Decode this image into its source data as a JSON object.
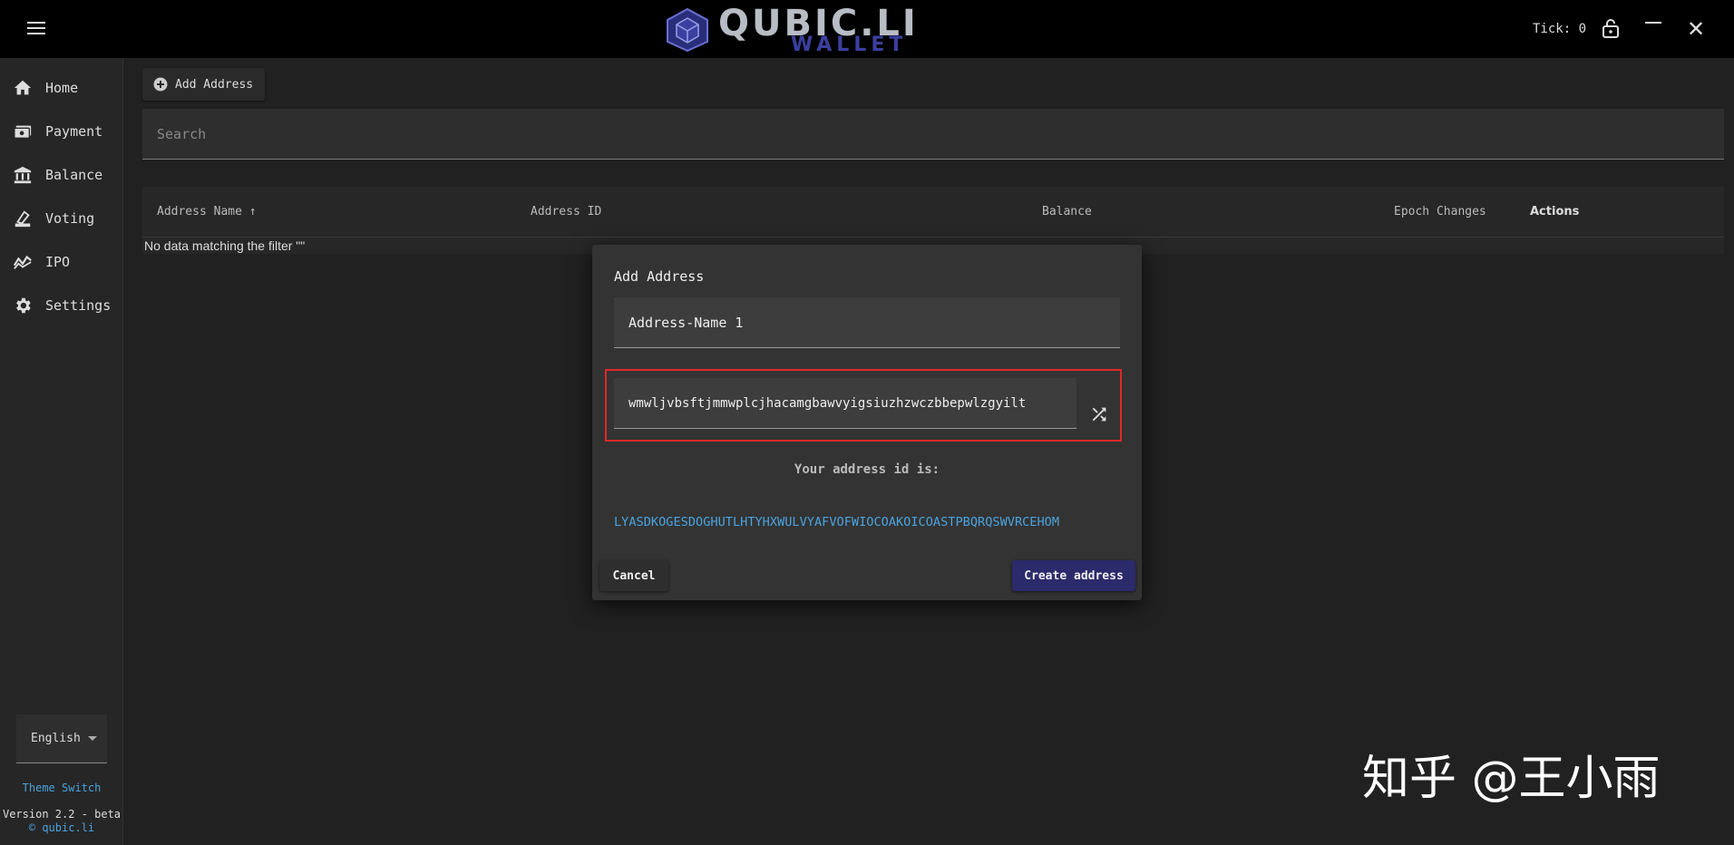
{
  "app": {
    "logo_top": "QUBIC.LI",
    "logo_bottom": "WALLET",
    "tick_text": "Tick: 0"
  },
  "sidebar": {
    "items": [
      {
        "label": "Home",
        "icon": "home-icon"
      },
      {
        "label": "Payment",
        "icon": "payment-icon"
      },
      {
        "label": "Balance",
        "icon": "bank-icon"
      },
      {
        "label": "Voting",
        "icon": "vote-icon"
      },
      {
        "label": "IPO",
        "icon": "trend-icon"
      },
      {
        "label": "Settings",
        "icon": "gear-icon"
      }
    ],
    "language": "English",
    "theme_switch": "Theme Switch",
    "version": "Version 2.2 - beta",
    "copyright": "© qubic.li"
  },
  "main": {
    "add_address_label": "Add Address",
    "search_placeholder": "Search",
    "table": {
      "columns": [
        "Address Name ↑",
        "Address ID",
        "Balance",
        "Epoch Changes",
        "Actions"
      ],
      "empty_text": "No data matching the filter \"\""
    }
  },
  "dialog": {
    "title": "Add Address",
    "name_value": "Address-Name 1",
    "seed_value": "wmwljvbsftjmmwplcjhacamgbawvyigsiuzhzwczbbepwlzgyilt",
    "your_id_label": "Your address id is:",
    "address_id": "LYASDKOGESDOGHUTLHTYHXWULVYAFVOFWIOCOAKOICOASTPBQRQSWVRCEHOM",
    "cancel_label": "Cancel",
    "create_label": "Create address"
  },
  "watermark": "知乎 @王小雨",
  "colors": {
    "accent_link": "#4aa3df",
    "primary_button": "#2b2a6b",
    "highlight_border": "#e02828"
  }
}
